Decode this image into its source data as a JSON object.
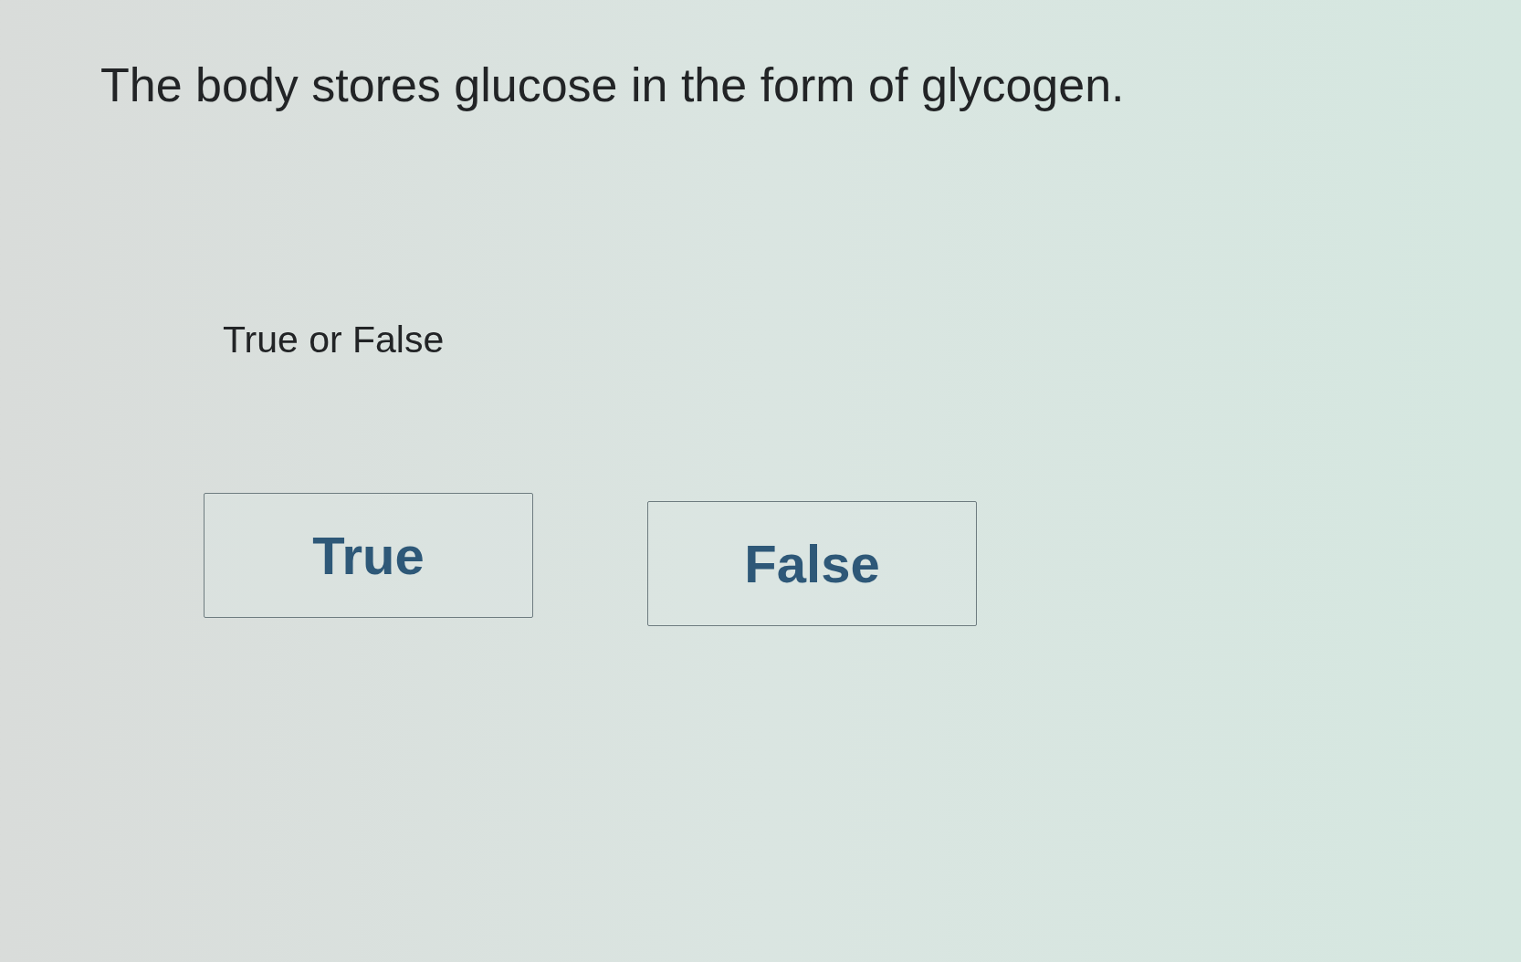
{
  "question": {
    "text": "The body stores glucose in the form of glycogen."
  },
  "prompt": "True or False",
  "options": [
    {
      "label": "True",
      "selected": false
    },
    {
      "label": "False",
      "selected": false
    }
  ]
}
